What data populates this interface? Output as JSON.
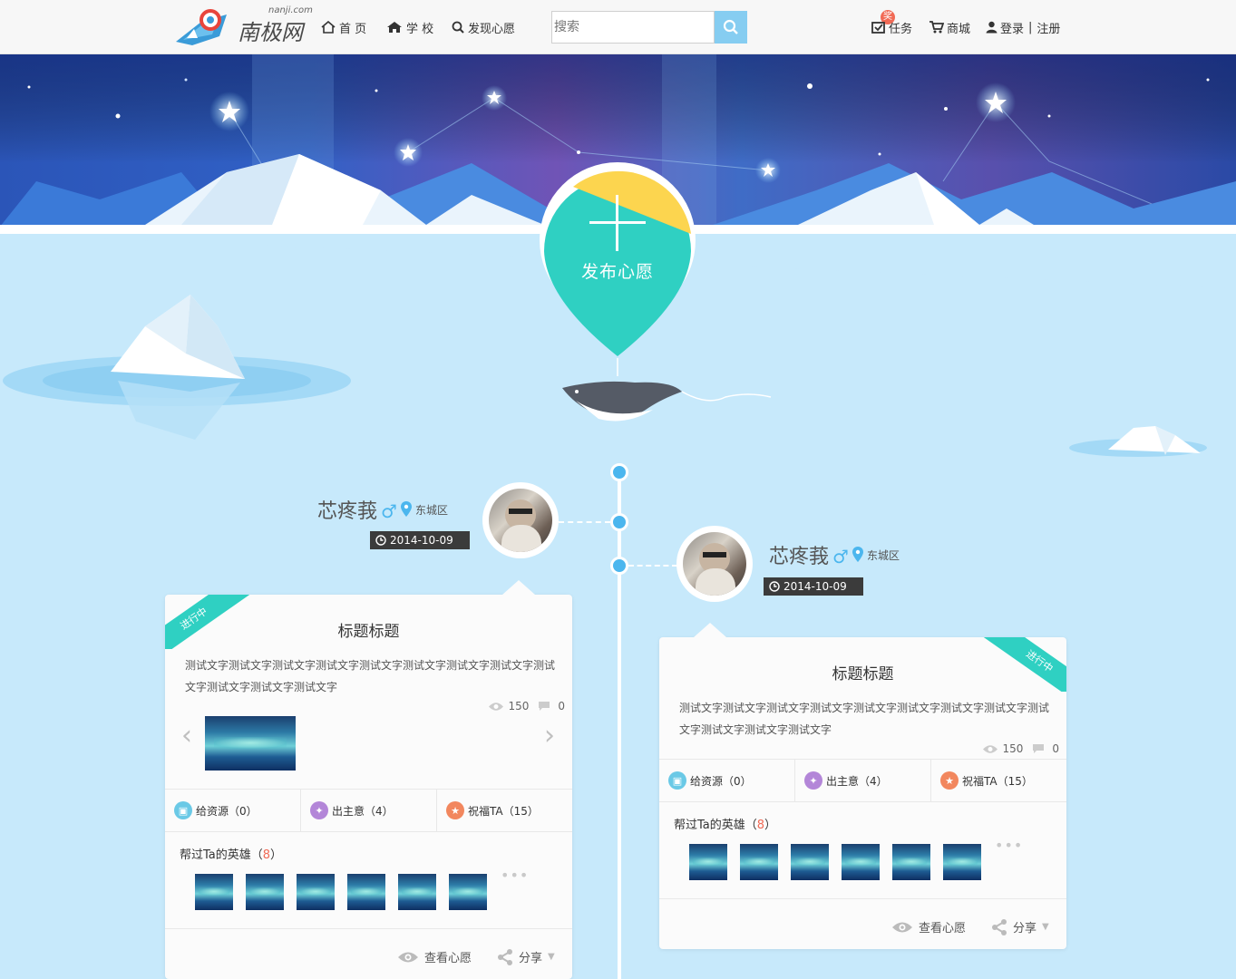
{
  "header": {
    "logo_text": "南极网",
    "logo_domain": "nanji.com",
    "nav": [
      {
        "label": "首 页",
        "icon": "home-icon"
      },
      {
        "label": "学 校",
        "icon": "school-icon"
      },
      {
        "label": "发现心愿",
        "icon": "search-icon"
      }
    ],
    "search_placeholder": "搜索",
    "tasks_badge": "奖",
    "tasks_label": "任务",
    "shop_label": "商城",
    "login_label": "登录",
    "separator": "|",
    "register_label": "注册"
  },
  "hero": {
    "publish_label": "发布心愿",
    "publish_icon": "plus-icon"
  },
  "colors": {
    "accent_blue": "#4bb6ee",
    "teal": "#2fd0c2",
    "yellow": "#fcd54f",
    "sky_bg": "#c7e9fb",
    "count_red": "#f16a55"
  },
  "posts": [
    {
      "user_name": "芯疼莪",
      "gender": "♂",
      "location": "东城区",
      "date": "2014-10-09",
      "status": "进行中",
      "title": "标题标题",
      "body": "测试文字测试文字测试文字测试文字测试文字测试文字测试文字测试文字测试文字测试文字测试文字测试文字",
      "views": "150",
      "comments": "0",
      "actions": [
        {
          "label": "给资源（0）",
          "icon": "cube-icon"
        },
        {
          "label": "出主意（4）",
          "icon": "lightbulb-icon"
        },
        {
          "label": "祝福TA（15）",
          "icon": "thumbs-up-icon"
        }
      ],
      "heroes_label": "帮过Ta的英雄（",
      "heroes_count": "8",
      "heroes_close": "）",
      "view_label": "查看心愿",
      "share_label": "分享"
    },
    {
      "user_name": "芯疼莪",
      "gender": "♂",
      "location": "东城区",
      "date": "2014-10-09",
      "status": "进行中",
      "title": "标题标题",
      "body": "测试文字测试文字测试文字测试文字测试文字测试文字测试文字测试文字测试文字测试文字测试文字测试文字",
      "views": "150",
      "comments": "0",
      "actions": [
        {
          "label": "给资源（0）",
          "icon": "cube-icon"
        },
        {
          "label": "出主意（4）",
          "icon": "lightbulb-icon"
        },
        {
          "label": "祝福TA（15）",
          "icon": "thumbs-up-icon"
        }
      ],
      "heroes_label": "帮过Ta的英雄（",
      "heroes_count": "8",
      "heroes_close": "）",
      "view_label": "查看心愿",
      "share_label": "分享"
    }
  ]
}
